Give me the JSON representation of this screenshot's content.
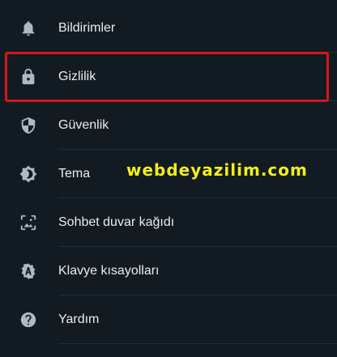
{
  "settings_menu": {
    "items": [
      {
        "label": "Bildirimler",
        "icon": "bell-icon"
      },
      {
        "label": "Gizlilik",
        "icon": "lock-icon"
      },
      {
        "label": "Güvenlik",
        "icon": "shield-icon"
      },
      {
        "label": "Tema",
        "icon": "theme-icon"
      },
      {
        "label": "Sohbet duvar kağıdı",
        "icon": "wallpaper-icon"
      },
      {
        "label": "Klavye kısayolları",
        "icon": "keyboard-shortcut-icon"
      },
      {
        "label": "Yardım",
        "icon": "help-icon"
      }
    ],
    "highlighted_item": "Gizlilik"
  },
  "watermark": {
    "text": "webdeyazilim.com",
    "color": "#f4ef19"
  },
  "colors": {
    "background": "#121b22",
    "text": "#e9edef",
    "icon": "#aebac1",
    "divider": "#222d34",
    "highlight": "#d9151b"
  }
}
